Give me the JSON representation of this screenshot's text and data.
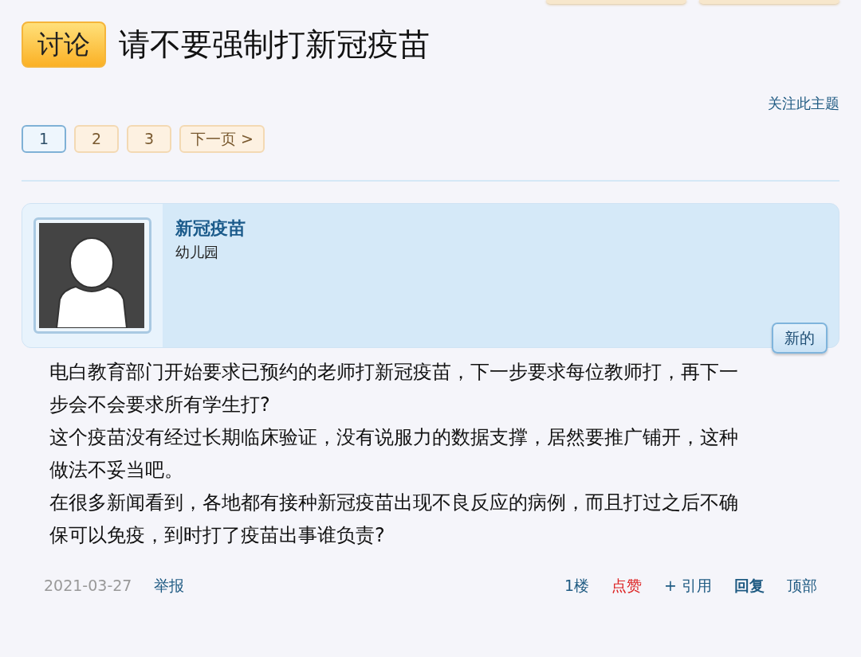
{
  "top_buttons": [
    {
      "kind": "cut"
    },
    {
      "kind": "cut"
    }
  ],
  "thread": {
    "prefix": "讨论",
    "title": "请不要强制打新冠疫苗",
    "watch_link": "关注此主题"
  },
  "pagination": [
    {
      "label": "1",
      "selected": true
    },
    {
      "label": "2",
      "selected": false
    },
    {
      "label": "3",
      "selected": false
    },
    {
      "label": "下一页 >",
      "selected": false
    }
  ],
  "post": {
    "author": "新冠疫苗",
    "user_title": "幼儿园",
    "new_badge": "新的",
    "paragraphs": [
      "电白教育部门开始要求已预约的老师打新冠疫苗，下一步要求每位教师打，再下一步会不会要求所有学生打?",
      "这个疫苗没有经过长期临床验证，没有说服力的数据支撑，居然要推广铺开，这种做法不妥当吧。",
      "在很多新闻看到，各地都有接种新冠疫苗出现不良反应的病例，而且打过之后不确保可以免疫，到时打了疫苗出事谁负责?"
    ],
    "footer_left": [
      {
        "kind": "date",
        "text": "2021-03-27"
      },
      {
        "kind": "link",
        "text": "举报"
      }
    ],
    "footer_right": [
      {
        "kind": "link",
        "text": "1楼"
      },
      {
        "kind": "like",
        "text": "点赞"
      },
      {
        "kind": "link",
        "text": "+ 引用"
      },
      {
        "kind": "bold",
        "text": "回复"
      },
      {
        "kind": "link",
        "text": "顶部"
      }
    ]
  }
}
